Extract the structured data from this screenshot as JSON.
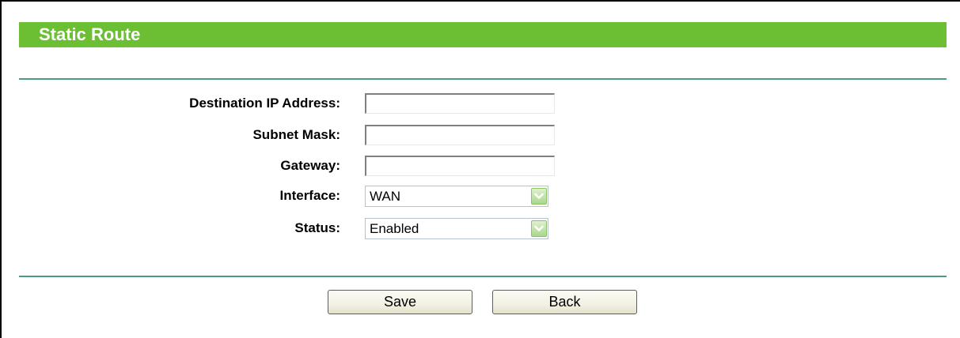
{
  "page": {
    "title": "Static Route"
  },
  "form": {
    "destination_ip": {
      "label": "Destination IP Address:",
      "value": ""
    },
    "subnet_mask": {
      "label": "Subnet Mask:",
      "value": ""
    },
    "gateway": {
      "label": "Gateway:",
      "value": ""
    },
    "interface": {
      "label": "Interface:",
      "selected": "WAN"
    },
    "status": {
      "label": "Status:",
      "selected": "Enabled"
    }
  },
  "buttons": {
    "save_label": "Save",
    "back_label": "Back"
  },
  "colors": {
    "title_bar": "#6cbe33",
    "divider": "#4c9b7a",
    "dropdown_arrow": "#a9d88a"
  },
  "icons": {
    "dropdown": "chevron-down-icon"
  }
}
